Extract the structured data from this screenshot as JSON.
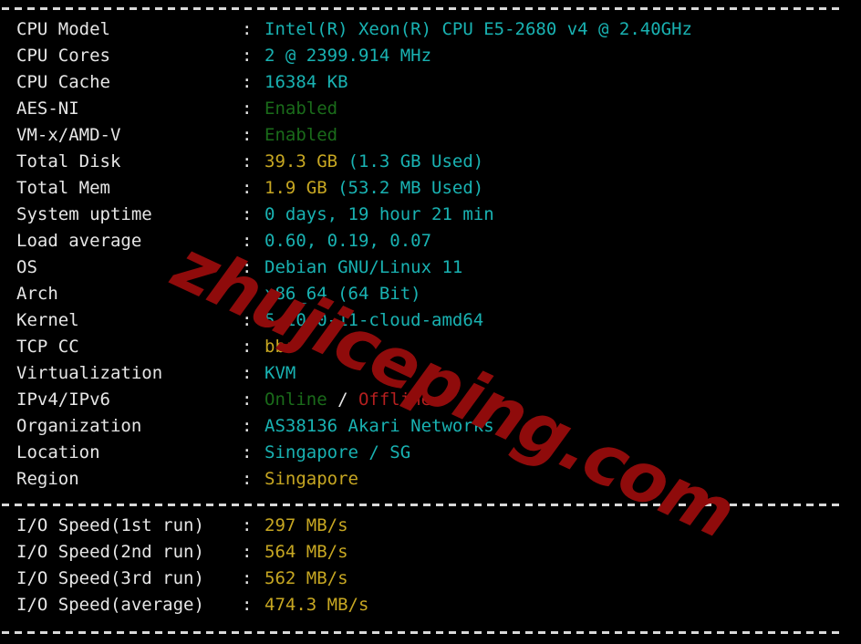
{
  "terminal": {
    "background_color": "#000000",
    "separator_char": "-",
    "colon": ":"
  },
  "watermark": {
    "text": "zhujiceping.com",
    "color": "#8f0b0b"
  },
  "colors": {
    "label": "#e6e6e6",
    "cyan": "#19b2b2",
    "yellow": "#c7a722",
    "green": "#1a6b1a",
    "red": "#b51f1f",
    "white": "#e6e6e6"
  },
  "system_info": [
    {
      "label": "CPU Model",
      "value": "Intel(R) Xeon(R) CPU E5-2680 v4 @ 2.40GHz",
      "color": "cyan"
    },
    {
      "label": "CPU Cores",
      "value": "2 @ 2399.914 MHz",
      "color": "cyan"
    },
    {
      "label": "CPU Cache",
      "value": "16384 KB",
      "color": "cyan"
    },
    {
      "label": "AES-NI",
      "value": "Enabled",
      "color": "green"
    },
    {
      "label": "VM-x/AMD-V",
      "value": "Enabled",
      "color": "green"
    },
    {
      "label": "Total Disk",
      "value": "39.3 GB ",
      "color": "yellow",
      "value2": "(1.3 GB Used)",
      "color2": "cyan"
    },
    {
      "label": "Total Mem",
      "value": "1.9 GB ",
      "color": "yellow",
      "value2": "(53.2 MB Used)",
      "color2": "cyan"
    },
    {
      "label": "System uptime",
      "value": "0 days, 19 hour 21 min",
      "color": "cyan"
    },
    {
      "label": "Load average",
      "value": "0.60, 0.19, 0.07",
      "color": "cyan"
    },
    {
      "label": "OS",
      "value": "Debian GNU/Linux 11",
      "color": "cyan"
    },
    {
      "label": "Arch",
      "value": "x86_64 (64 Bit)",
      "color": "cyan"
    },
    {
      "label": "Kernel",
      "value": "5.10.0-11-cloud-amd64",
      "color": "cyan"
    },
    {
      "label": "TCP CC",
      "value": "bbr",
      "color": "yellow"
    },
    {
      "label": "Virtualization",
      "value": "KVM",
      "color": "cyan"
    },
    {
      "label": "IPv4/IPv6",
      "value": "Online",
      "color": "green",
      "value2": " / ",
      "color2": "white",
      "value3": "Offline",
      "color3": "red"
    },
    {
      "label": "Organization",
      "value": "AS38136 Akari Networks",
      "color": "cyan"
    },
    {
      "label": "Location",
      "value": "Singapore / SG",
      "color": "cyan"
    },
    {
      "label": "Region",
      "value": "Singapore",
      "color": "yellow"
    }
  ],
  "io_speed": [
    {
      "label": "I/O Speed(1st run)",
      "value": "297 MB/s",
      "color": "yellow"
    },
    {
      "label": "I/O Speed(2nd run)",
      "value": "564 MB/s",
      "color": "yellow"
    },
    {
      "label": "I/O Speed(3rd run)",
      "value": "562 MB/s",
      "color": "yellow"
    },
    {
      "label": "I/O Speed(average)",
      "value": "474.3 MB/s",
      "color": "yellow"
    }
  ]
}
